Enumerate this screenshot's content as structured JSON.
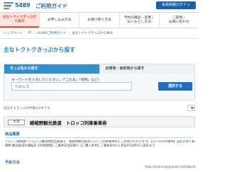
{
  "header": {
    "logo_text": "5489",
    "title": "ご利用ガイド",
    "members_button": "会員情報ログイン"
  },
  "nav": {
    "items": [
      {
        "label": "主なトクトクきっぷから探す",
        "active": true
      },
      {
        "label": "お申し込み方法",
        "active": false
      },
      {
        "label": "お受け取り方法",
        "active": false
      },
      {
        "label": "予約の確認・変更・\n払いもどし方法",
        "active": false
      },
      {
        "label": "ご質問・\nお問い合わせ",
        "active": false
      }
    ]
  },
  "breadcrumb": {
    "items": [
      "トップページ",
      "JR",
      "e5489ご利用ガイド"
    ],
    "current": "主なトクトクきっぷから探す"
  },
  "page": {
    "title": "主なトクトクきっぷから探す"
  },
  "search": {
    "tab_active": "きっぷ名から探す",
    "tab_inactive": "出発地・目的地から探す",
    "label": "キーワードを入力してください。（「こだま」「早特」など）",
    "input_value": "トロッコ",
    "button": "選択する"
  },
  "results": {
    "count_text": "該当するきっぷの件数は1件です。"
  },
  "result": {
    "badge": "片道",
    "title": "嵯峨野観光鉄道　トロッコ列車乗車券",
    "section1": "商品概要",
    "description": "トロッコ嵯峨野～トロッコ亀岡間相当運賃を、嵯峨野観光鉄道トロッコ列車乗車券とご利用いただけます。【ロ～10/29運用】設定を除く嵯峨野 観光鉄道の運転日【利用期間】ご乗車日当日限り【ご購入条件】ご乗車日の1ヶ月前の10時から前日まで",
    "section2": "予約方法"
  },
  "watermark": "http://marsray.pixnet.net/album"
}
